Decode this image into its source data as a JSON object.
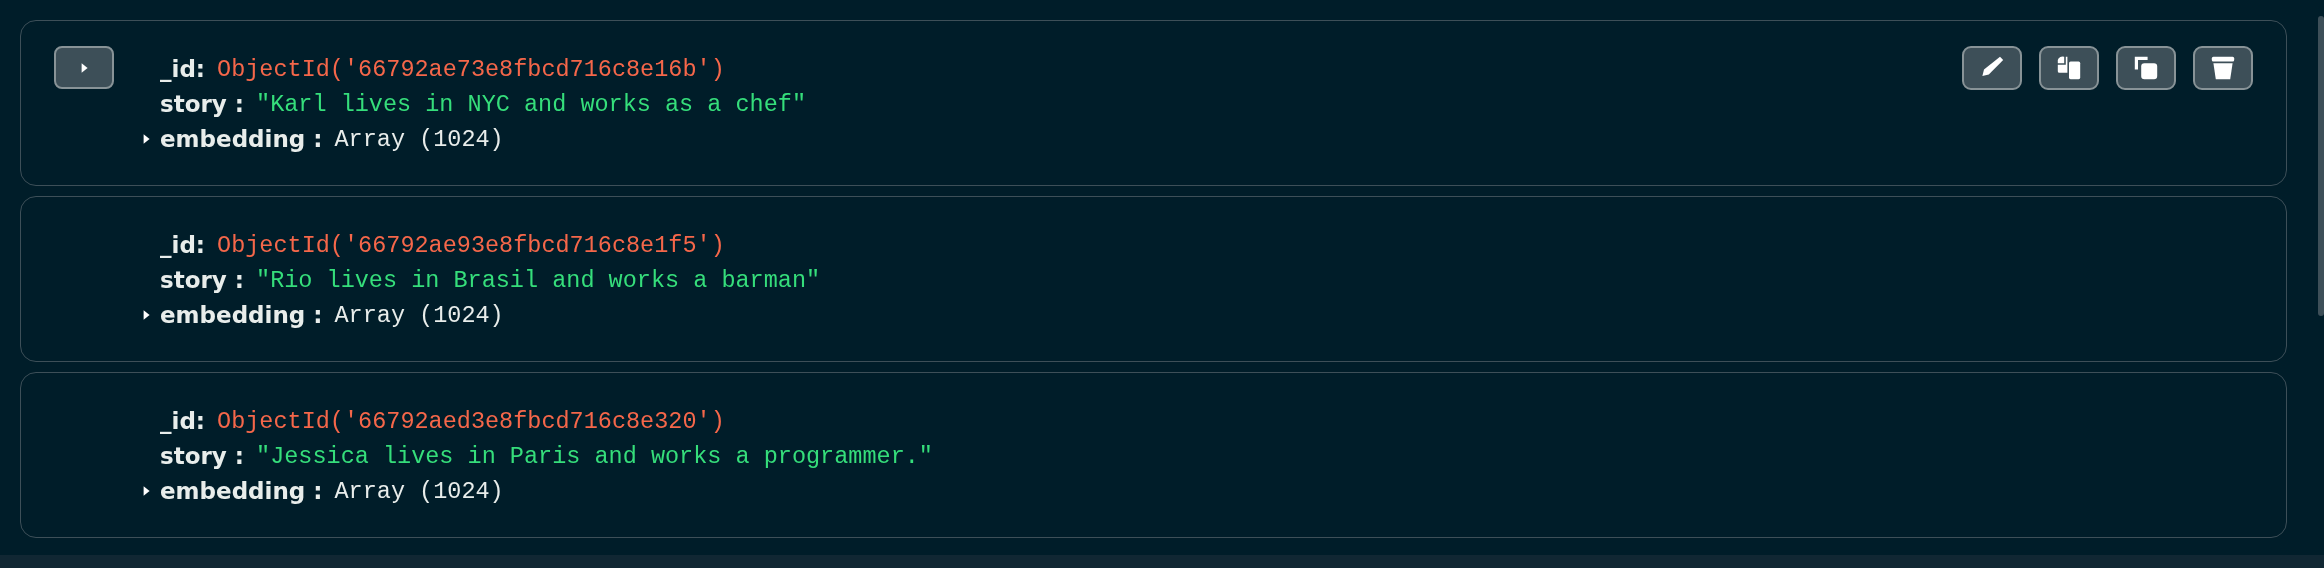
{
  "documents": [
    {
      "hovered": true,
      "fields": [
        {
          "key": "_id:",
          "kind": "objectid",
          "value": "ObjectId('66792ae73e8fbcd716c8e16b')"
        },
        {
          "key": "story :",
          "kind": "string",
          "value": "\"Karl lives in NYC and works as a chef\""
        },
        {
          "key": "embedding :",
          "kind": "array",
          "value": "Array (1024)",
          "expanded": false
        }
      ]
    },
    {
      "hovered": false,
      "fields": [
        {
          "key": "_id:",
          "kind": "objectid",
          "value": "ObjectId('66792ae93e8fbcd716c8e1f5')"
        },
        {
          "key": "story :",
          "kind": "string",
          "value": "\"Rio lives in Brasil and works a barman\""
        },
        {
          "key": "embedding :",
          "kind": "array",
          "value": "Array (1024)",
          "expanded": false
        }
      ]
    },
    {
      "hovered": false,
      "fields": [
        {
          "key": "_id:",
          "kind": "objectid",
          "value": "ObjectId('66792aed3e8fbcd716c8e320')"
        },
        {
          "key": "story :",
          "kind": "string",
          "value": "\"Jessica lives in Paris and works a programmer.\""
        },
        {
          "key": "embedding :",
          "kind": "array",
          "value": "Array (1024)",
          "expanded": false
        }
      ]
    }
  ]
}
